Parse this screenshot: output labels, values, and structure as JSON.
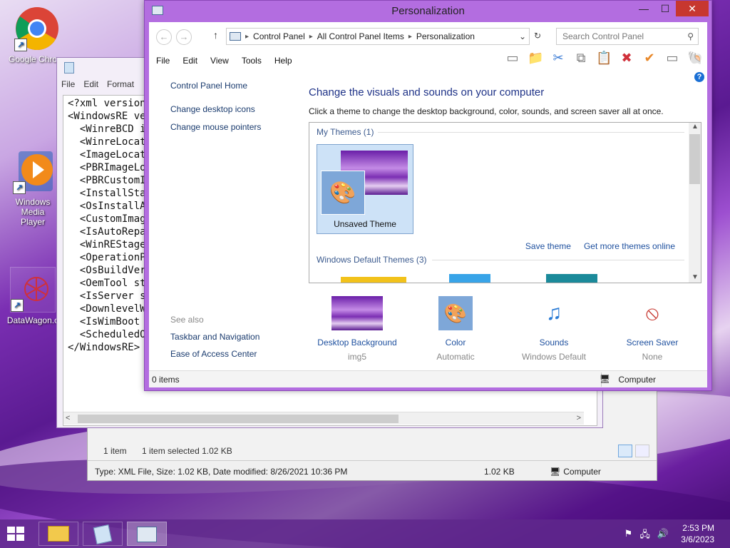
{
  "desktop": {
    "icons": [
      {
        "label": "Google Chrome"
      },
      {
        "label": "Windows Media Player"
      },
      {
        "label": "DataWagon.c"
      }
    ]
  },
  "notepad": {
    "menu": [
      "File",
      "Edit",
      "Format"
    ],
    "lines": [
      "<?xml version=",
      "<WindowsRE ver",
      "  <WinreBCD ic",
      "  <WinreLocati",
      "  <ImageLocati",
      "  <PBRImageLoc",
      "  <PBRCustomIm",
      "  <InstallStat",
      "  <OsInstallAv",
      "  <CustomImage",
      "  <IsAutoRepai",
      "  <WinREStaged",
      "  <OperationPa",
      "  <OsBuildVers",
      "  <OemTool sta",
      "  <IsServer st",
      "  <DownlevelWi",
      "  <IsWimBoot s",
      "  <ScheduledOp",
      "</WindowsRE>"
    ]
  },
  "explorer": {
    "item_count": "1 item",
    "selected": "1 item selected  1.02 KB",
    "status_info": "Type: XML File, Size: 1.02 KB, Date modified: 8/26/2021 10:36 PM",
    "status_size": "1.02 KB",
    "status_location": "Computer"
  },
  "personalization": {
    "title": "Personalization",
    "address": [
      "Control Panel",
      "All Control Panel Items",
      "Personalization"
    ],
    "search_placeholder": "Search Control Panel",
    "menu": {
      "file": "File",
      "edit": "Edit",
      "view": "View",
      "tools": "Tools",
      "help": "Help"
    },
    "left_nav": {
      "home": "Control Panel Home",
      "desktop_icons": "Change desktop icons",
      "mouse_pointers": "Change mouse pointers"
    },
    "see_also": {
      "heading": "See also",
      "taskbar": "Taskbar and Navigation",
      "ease": "Ease of Access Center"
    },
    "heading": "Change the visuals and sounds on your computer",
    "subheading": "Click a theme to change the desktop background, color, sounds, and screen saver all at once.",
    "my_themes_label": "My Themes (1)",
    "unsaved_theme": "Unsaved Theme",
    "save_theme": "Save theme",
    "get_more": "Get more themes online",
    "default_themes_label": "Windows Default Themes (3)",
    "options": [
      {
        "label": "Desktop Background",
        "value": "img5"
      },
      {
        "label": "Color",
        "value": "Automatic"
      },
      {
        "label": "Sounds",
        "value": "Windows Default"
      },
      {
        "label": "Screen Saver",
        "value": "None"
      }
    ],
    "status_items": "0 items",
    "status_location": "Computer"
  },
  "taskbar": {
    "time": "2:53 PM",
    "date": "3/6/2023"
  },
  "colors": {
    "accent": "#b36de0",
    "link": "#1d4f9e",
    "close": "#c7372f"
  }
}
